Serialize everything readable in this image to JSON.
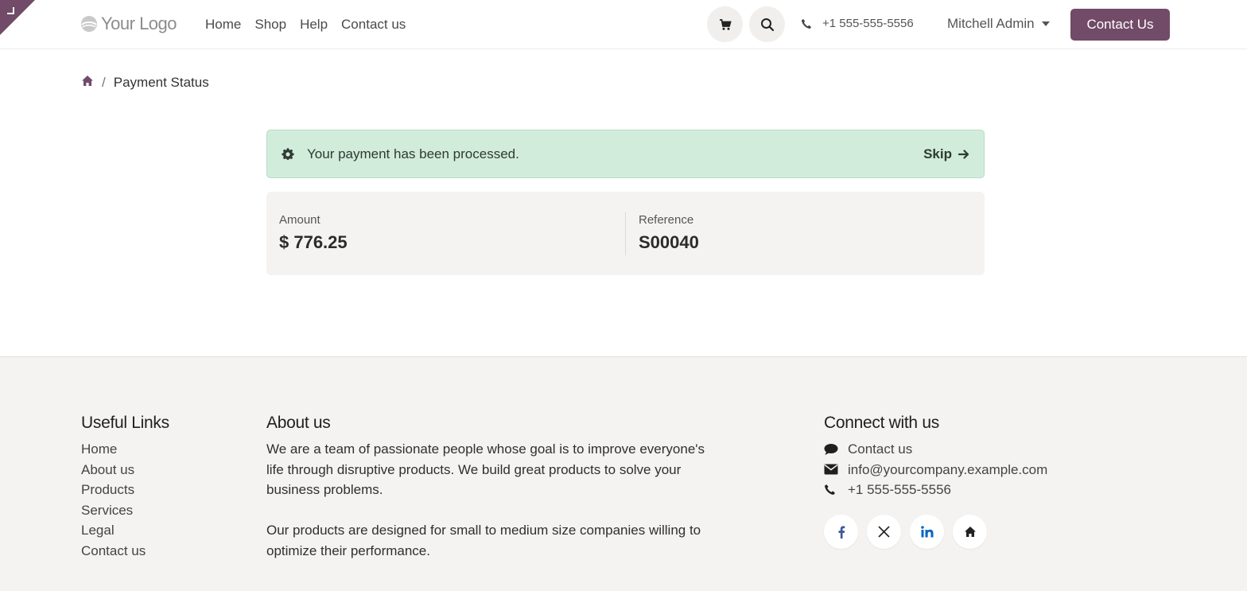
{
  "header": {
    "logo_text": "Your Logo",
    "nav": [
      "Home",
      "Shop",
      "Help",
      "Contact us"
    ],
    "phone": "+1 555-555-5556",
    "user": "Mitchell Admin",
    "cta_label": "Contact Us",
    "brand_color": "#714b67"
  },
  "breadcrumb": {
    "current": "Payment Status"
  },
  "alert": {
    "message": "Your payment has been processed.",
    "skip_label": "Skip"
  },
  "summary": {
    "amount_label": "Amount",
    "amount_value": "$ 776.25",
    "reference_label": "Reference",
    "reference_value": "S00040"
  },
  "footer": {
    "useful_links_title": "Useful Links",
    "useful_links": [
      "Home",
      "About us",
      "Products",
      "Services",
      "Legal",
      "Contact us"
    ],
    "about_title": "About us",
    "about_paragraphs": [
      "We are a team of passionate people whose goal is to improve everyone's life through disruptive products. We build great products to solve your business problems.",
      "Our products are designed for small to medium size companies willing to optimize their performance."
    ],
    "connect_title": "Connect with us",
    "connect_items": [
      {
        "icon": "comment-icon",
        "text": "Contact us"
      },
      {
        "icon": "envelope-icon",
        "text": "info@yourcompany.example.com"
      },
      {
        "icon": "phone-icon",
        "text": "+1 555-555-5556"
      }
    ],
    "social_icons": [
      "facebook-icon",
      "x-twitter-icon",
      "linkedin-icon",
      "home-icon"
    ]
  }
}
